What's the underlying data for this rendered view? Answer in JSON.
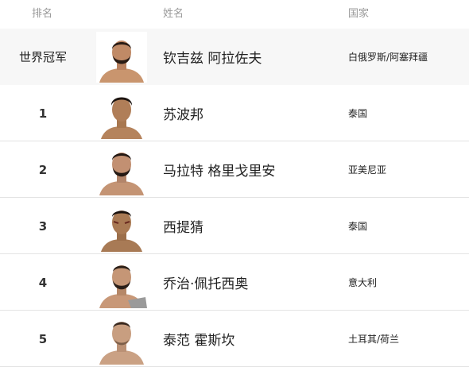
{
  "header": {
    "rank_label": "排名",
    "name_label": "姓名",
    "country_label": "国家"
  },
  "rankings": [
    {
      "rank": "世界冠军",
      "name": "钦吉兹 阿拉佐夫",
      "country": "白俄罗斯/阿塞拜疆",
      "photo_icon": "fighter-avatar-icon"
    },
    {
      "rank": "1",
      "name": "苏波邦",
      "country": "泰国",
      "photo_icon": "fighter-avatar-icon"
    },
    {
      "rank": "2",
      "name": "马拉特 格里戈里安",
      "country": "亚美尼亚",
      "photo_icon": "fighter-avatar-icon"
    },
    {
      "rank": "3",
      "name": "西提猜",
      "country": "泰国",
      "photo_icon": "fighter-avatar-icon"
    },
    {
      "rank": "4",
      "name": "乔治·佩托西奥",
      "country": "意大利",
      "photo_icon": "fighter-avatar-icon"
    },
    {
      "rank": "5",
      "name": "泰范 霍斯坎",
      "country": "土耳其/荷兰",
      "photo_icon": "fighter-avatar-icon"
    }
  ]
}
